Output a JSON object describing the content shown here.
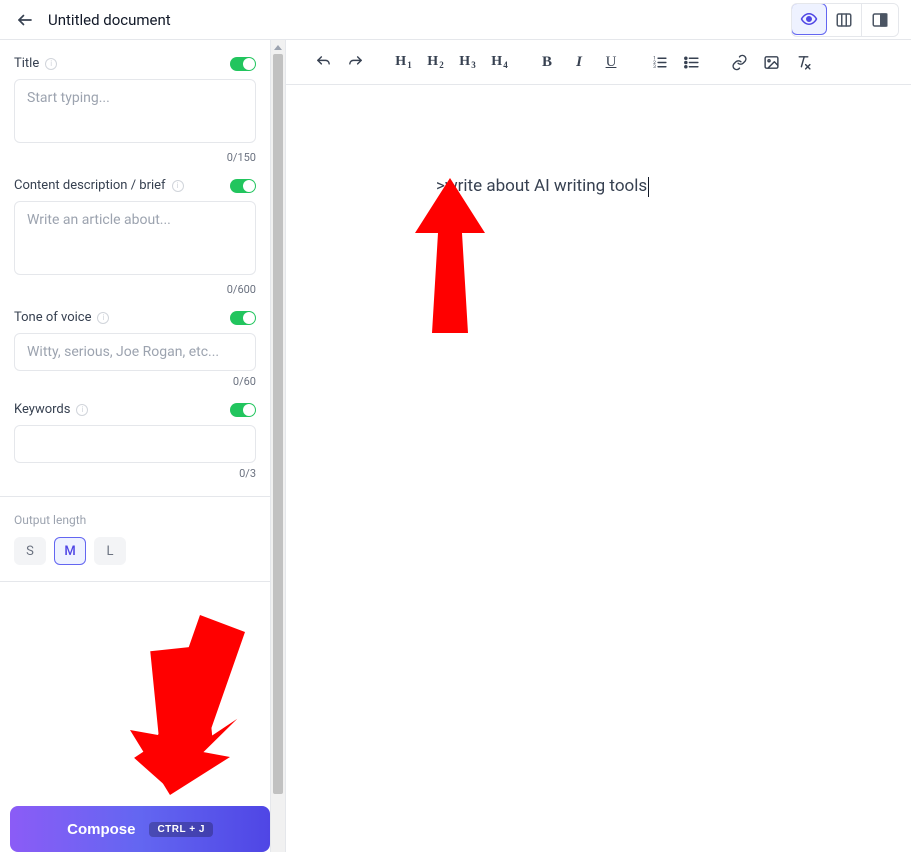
{
  "header": {
    "doc_title": "Untitled document"
  },
  "sidebar": {
    "title": {
      "label": "Title",
      "placeholder": "Start typing...",
      "counter": "0/150"
    },
    "brief": {
      "label": "Content description / brief",
      "placeholder": "Write an article about...",
      "counter": "0/600"
    },
    "tone": {
      "label": "Tone of voice",
      "placeholder": "Witty, serious, Joe Rogan, etc...",
      "counter": "0/60"
    },
    "keywords": {
      "label": "Keywords",
      "counter": "0/3"
    },
    "output": {
      "label": "Output length",
      "options": [
        "S",
        "M",
        "L"
      ],
      "selected": "M"
    },
    "compose": {
      "label": "Compose",
      "shortcut": "CTRL + J"
    }
  },
  "toolbar": {
    "headings": [
      "1",
      "2",
      "3",
      "4"
    ]
  },
  "editor": {
    "content": ">write about AI writing tools"
  }
}
